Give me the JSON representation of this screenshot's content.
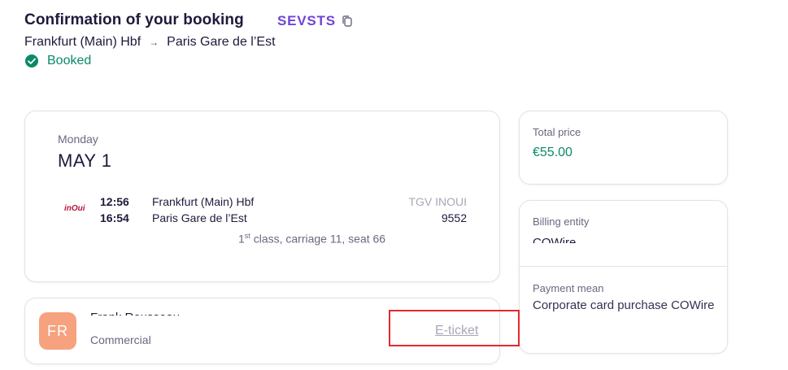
{
  "header": {
    "title": "Confirmation of your booking",
    "reference": "SEVSTS",
    "origin": "Frankfurt (Main) Hbf",
    "destination": "Paris Gare de l’Est",
    "arrow": "→",
    "status": "Booked"
  },
  "trip": {
    "day": "Monday",
    "date": "MAY 1",
    "operator_logo": "inOui",
    "departure_time": "12:56",
    "arrival_time": "16:54",
    "departure_station": "Frankfurt (Main) Hbf",
    "arrival_station": "Paris Gare de l’Est",
    "operator": "TGV INOUI",
    "train_number": "9552",
    "class_ordinal": "1",
    "class_suffix": "st",
    "seat_info": " class, carriage 11, seat 66"
  },
  "passenger": {
    "initials": "FR",
    "name": "Frank Rousseau",
    "role": "Commercial",
    "eticket_label": "E-ticket"
  },
  "price": {
    "label": "Total price",
    "value": "€55.00"
  },
  "billing": {
    "entity_label": "Billing entity",
    "entity_value": "COWire",
    "payment_label": "Payment mean",
    "payment_value": "Corporate card purchase COWire"
  },
  "colors": {
    "accent": "#6f45d6",
    "success": "#0a8a66",
    "avatar": "#f7a27f",
    "highlight": "#e02b2b"
  }
}
